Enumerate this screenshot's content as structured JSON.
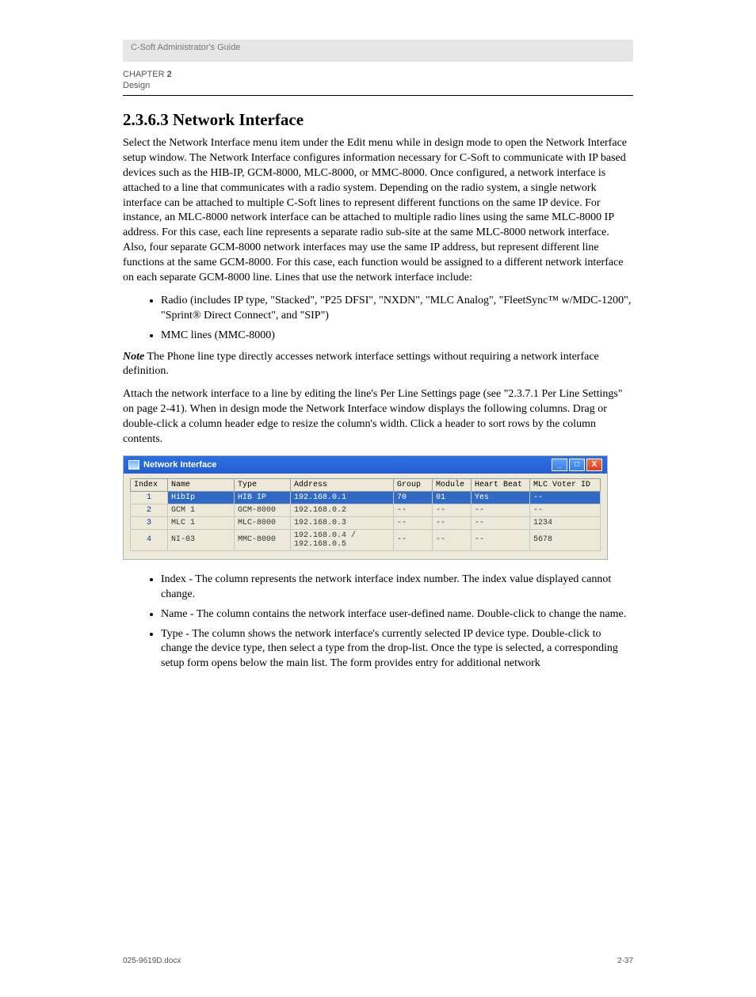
{
  "header": {
    "left": "C-Soft Administrator's Guide",
    "right": "",
    "chapter": "CHAPTER",
    "chapter_rest": "2",
    "section": "Design"
  },
  "title": "2.3.6.3 Network Interface",
  "paragraphs": {
    "p1": "Select the Network Interface menu item under the Edit menu while in design mode to open the Network Interface setup window. The Network Interface configures information necessary for C-Soft to communicate with IP based devices such as the HIB-IP, GCM-8000, MLC-8000, or MMC-8000. Once configured, a network interface is attached to a line that communicates with a radio system. Depending on the radio system, a single network interface can be attached to multiple C-Soft lines to represent different functions on the same IP device. For instance, an MLC-8000 network interface can be attached to multiple radio lines using the same MLC-8000 IP address. For this case, each line represents a separate radio sub-site at the same MLC-8000 network interface. Also, four separate GCM-8000 network interfaces may use the same IP address, but represent different line functions at the same GCM-8000. For this case, each function would be assigned to a different network interface on each separate GCM-8000 line. Lines that use the network interface include:",
    "lines_label": "",
    "p2": "Attach the network interface to a line by editing the line's Per Line Settings page (see \"2.3.7.1 Per Line Settings\" on page 2-41). When in design mode the Network Interface window displays the following columns. Drag or double-click a column header edge to resize the column's width. Click a header to sort rows by the column contents."
  },
  "line_types": [
    "Radio (includes IP type, \"Stacked\", \"P25 DFSI\", \"NXDN\", \"MLC Analog\", \"FleetSync™ w/MDC-1200\", \"Sprint® Direct Connect\", and \"SIP\")",
    "MMC lines (MMC-8000)"
  ],
  "columns": [
    "Index - The column represents the network interface index number. The index value displayed cannot change.",
    "Name - The column contains the network interface user-defined name. Double-click to change the name.",
    "Type - The column shows the network interface's currently selected IP device type. Double-click to change the device type, then select a type from the drop-list. Once the type is selected, a corresponding setup form opens below the main list. The form provides entry for additional network"
  ],
  "window": {
    "title": "Network Interface",
    "headers": [
      "Index",
      "Name",
      "Type",
      "Address",
      "Group",
      "Module",
      "Heart Beat",
      "MLC Voter ID"
    ],
    "rows": [
      {
        "idx": "1",
        "name": "HibIp",
        "type": "HIB IP",
        "addr": "192.168.0.1",
        "group": "70",
        "module": "01",
        "hb": "Yes",
        "mlc": "--",
        "selected": true
      },
      {
        "idx": "2",
        "name": "GCM 1",
        "type": "GCM-8000",
        "addr": "192.168.0.2",
        "group": "--",
        "module": "--",
        "hb": "--",
        "mlc": "--",
        "selected": false
      },
      {
        "idx": "3",
        "name": "MLC 1",
        "type": "MLC-8000",
        "addr": "192.168.0.3",
        "group": "--",
        "module": "--",
        "hb": "--",
        "mlc": "1234",
        "selected": false
      },
      {
        "idx": "4",
        "name": "NI-03",
        "type": "MMC-8000",
        "addr": "192.168.0.4 / 192.168.0.5",
        "group": "--",
        "module": "--",
        "hb": "--",
        "mlc": "5678",
        "selected": false
      }
    ]
  },
  "note": {
    "label": "Note",
    "text": "The Phone line type directly accesses network interface settings without requiring a network interface definition."
  },
  "footer": {
    "left": "025-9619D.docx",
    "right": "2-37"
  }
}
